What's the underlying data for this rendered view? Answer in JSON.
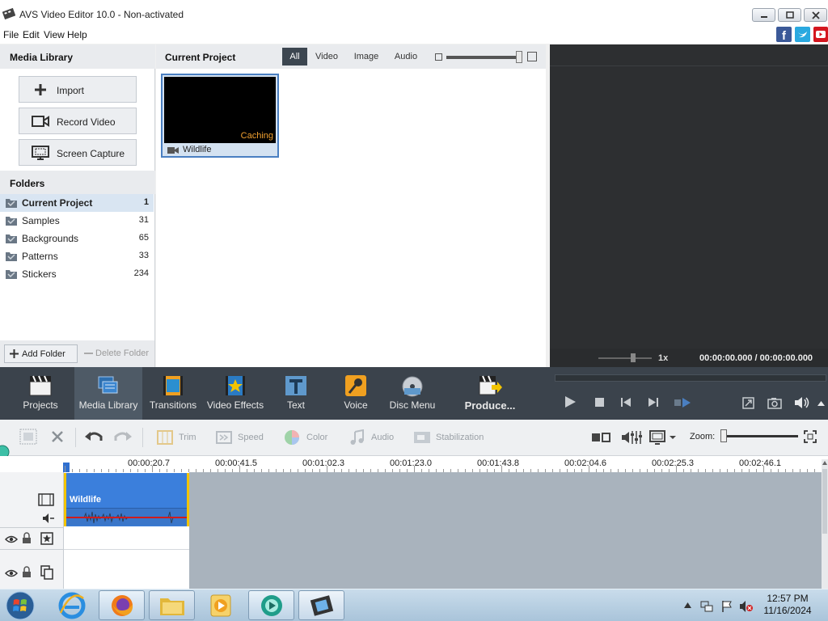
{
  "window": {
    "title": "AVS Video Editor 10.0 - Non-activated"
  },
  "menu": [
    "File",
    "Edit",
    "View",
    "Help"
  ],
  "media_library": {
    "header": "Media Library",
    "buttons": [
      {
        "label": "Import",
        "icon": "plus-icon"
      },
      {
        "label": "Record Video",
        "icon": "camera-icon"
      },
      {
        "label": "Screen Capture",
        "icon": "monitor-icon"
      }
    ],
    "folders_header": "Folders",
    "folders": [
      {
        "name": "Current Project",
        "count": "1"
      },
      {
        "name": "Samples",
        "count": "31"
      },
      {
        "name": "Backgrounds",
        "count": "65"
      },
      {
        "name": "Patterns",
        "count": "33"
      },
      {
        "name": "Stickers",
        "count": "234"
      }
    ],
    "add_folder": "Add Folder",
    "delete_folder": "Delete Folder"
  },
  "current_project": {
    "header": "Current Project",
    "filters": [
      "All",
      "Video",
      "Image",
      "Audio"
    ],
    "clip": {
      "name": "Wildlife",
      "status": "Caching"
    }
  },
  "preview": {
    "speed": "1x",
    "time": "00:00:00.000  /  00:00:00.000"
  },
  "toolbar": {
    "items": [
      "Projects",
      "Media Library",
      "Transitions",
      "Video Effects",
      "Text",
      "Voice",
      "Disc Menu",
      "Produce..."
    ]
  },
  "timeline_toolbar": {
    "items": [
      "Trim",
      "Speed",
      "Color",
      "Audio",
      "Stabilization"
    ],
    "zoom_label": "Zoom:"
  },
  "ruler": [
    "00:00:20.7",
    "00:00:41.5",
    "00:01:02.3",
    "00:01:23.0",
    "00:01:43.8",
    "00:02:04.6",
    "00:02:25.3",
    "00:02:46.1"
  ],
  "timeline_clip": {
    "name": "Wildlife"
  },
  "taskbar": {
    "time": "12:57 PM",
    "date": "11/16/2024"
  },
  "colors": {
    "accent": "#3b7fdc",
    "toolbar_bg": "#3b434c",
    "preview_bg": "#2d2f31"
  }
}
